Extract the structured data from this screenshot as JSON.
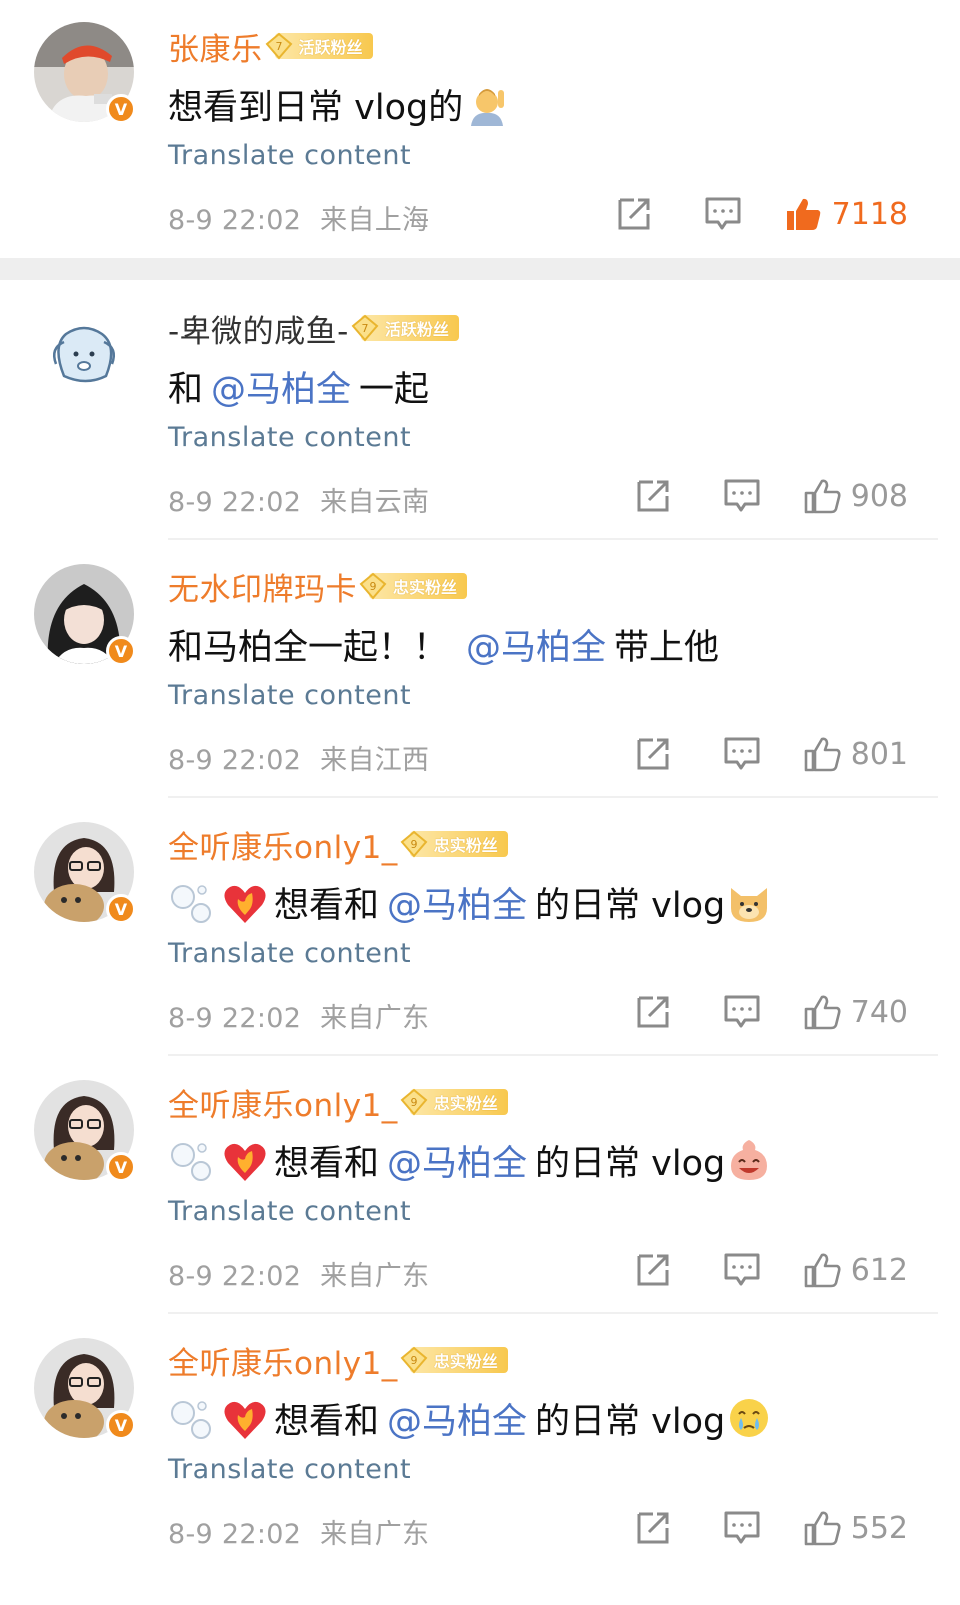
{
  "comments": [
    {
      "user": "张康乐",
      "fan_level": "7",
      "fan_label": "活跃粉丝",
      "text_before": "想看到日常 vlog的",
      "mention": "",
      "text_after": "",
      "translate": "Translate content",
      "time": "8-9 22:02",
      "location": "来自上海",
      "likes": "7118",
      "liked": true,
      "verified": true
    },
    {
      "user": "-卑微的咸鱼-",
      "fan_level": "7",
      "fan_label": "活跃粉丝",
      "text_before": "和",
      "mention": "@马柏全",
      "text_after": "一起",
      "translate": "Translate content",
      "time": "8-9 22:02",
      "location": "来自云南",
      "likes": "908",
      "liked": false,
      "verified": false
    },
    {
      "user": "无水印牌玛卡",
      "fan_level": "9",
      "fan_label": "忠实粉丝",
      "text_before": "和马柏全一起！！",
      "mention": "@马柏全",
      "text_after": "带上他",
      "translate": "Translate content",
      "time": "8-9 22:02",
      "location": "来自江西",
      "likes": "801",
      "liked": false,
      "verified": true
    },
    {
      "user": "全听康乐only1_",
      "fan_level": "9",
      "fan_label": "忠实粉丝",
      "text_before": "想看和",
      "mention": "@马柏全",
      "text_after": "的日常 vlog",
      "translate": "Translate content",
      "time": "8-9 22:02",
      "location": "来自广东",
      "likes": "740",
      "liked": false,
      "verified": true
    },
    {
      "user": "全听康乐only1_",
      "fan_level": "9",
      "fan_label": "忠实粉丝",
      "text_before": "想看和",
      "mention": "@马柏全",
      "text_after": "的日常 vlog",
      "translate": "Translate content",
      "time": "8-9 22:02",
      "location": "来自广东",
      "likes": "612",
      "liked": false,
      "verified": true
    },
    {
      "user": "全听康乐only1_",
      "fan_level": "9",
      "fan_label": "忠实粉丝",
      "text_before": "想看和",
      "mention": "@马柏全",
      "text_after": "的日常 vlog",
      "translate": "Translate content",
      "time": "8-9 22:02",
      "location": "来自广东",
      "likes": "552",
      "liked": false,
      "verified": true
    }
  ],
  "colors": {
    "username": "#ee7c2b",
    "mention": "#4b74c5",
    "translate": "#5b7a94",
    "meta": "#a0a0a0",
    "like_active": "#f06a1e"
  },
  "icons": {
    "repost": "share-arrow-icon",
    "comment": "comment-bubble-icon",
    "like": "thumbs-up-icon",
    "verified": "verified-v-icon",
    "fan_badge": "diamond-level-icon"
  }
}
